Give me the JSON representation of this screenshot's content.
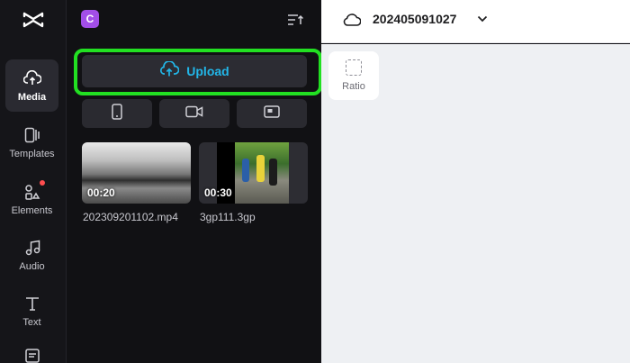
{
  "nav": {
    "items": [
      {
        "label": "Media",
        "icon": "cloud-upload-icon",
        "active": true
      },
      {
        "label": "Templates",
        "icon": "templates-icon"
      },
      {
        "label": "Elements",
        "icon": "elements-icon"
      },
      {
        "label": "Audio",
        "icon": "music-note-icon"
      },
      {
        "label": "Text",
        "icon": "text-icon"
      }
    ]
  },
  "panel": {
    "space_initial": "C",
    "upload_label": "Upload",
    "format_buttons": [
      "phone-icon",
      "camera-icon",
      "screen-icon"
    ],
    "media": [
      {
        "duration": "00:20",
        "filename": "202309201102.mp4"
      },
      {
        "duration": "00:30",
        "filename": "3gp111.3gp"
      }
    ]
  },
  "header": {
    "project_name": "202405091027"
  },
  "canvas": {
    "ratio_label": "Ratio"
  },
  "colors": {
    "accent": "#22b6e8",
    "highlight": "#22e022",
    "space_badge": "#a34ee8",
    "notification": "#ff4d4f"
  }
}
